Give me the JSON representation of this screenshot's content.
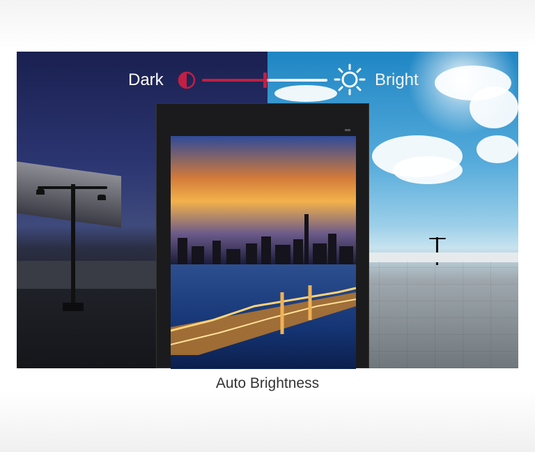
{
  "slider": {
    "left_label": "Dark",
    "right_label": "Bright",
    "left_icon": "half-circle-contrast-icon",
    "right_icon": "sun-icon",
    "level": 0.5,
    "accent_color": "#c21f42"
  },
  "caption": "Auto Brightness"
}
